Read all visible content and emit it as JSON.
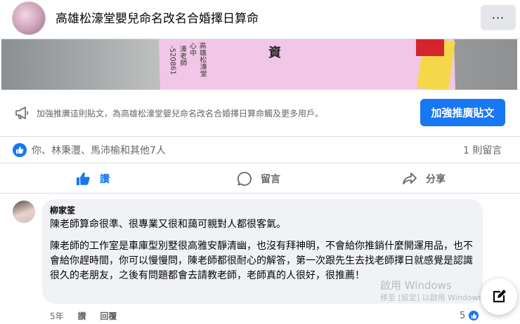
{
  "header": {
    "page_title": "高雄松濠堂嬰兒命名改名合婚擇日算命",
    "more_label": "···"
  },
  "photo": {
    "big_char": "資",
    "line1": "心中",
    "line2": "高雄松濠堂",
    "line3": "濠老師",
    "line4": "-520861"
  },
  "boost": {
    "text": "加強推廣這則貼文，為高雄松濠堂嬰兒命名改名合婚擇日算命觸及更多用戶。",
    "button_label": "加強推廣貼文"
  },
  "reactions": {
    "names": "你、林秉灃、馬沛榆和其他7人",
    "comment_count": "1 則留言"
  },
  "actions": {
    "like": "讚",
    "comment": "留言",
    "share": "分享"
  },
  "comment": {
    "author": "柳家筌",
    "p1": "陳老師算命很準、很專業又很和藹可親對人都很客氣。",
    "p2": "陳老師的工作室是車庫型別墅很高雅安靜清幽，也沒有拜神明，不會給你推銷什麼開運用品，也不會給你趕時間，你可以慢慢問，陳老師都很耐心的解答，第一次跟先生去找老師擇日就感覺是認識很久的老朋友，之後有問題都會去請教老師，老師真的人很好，很推薦！",
    "time": "5年",
    "like_label": "讚",
    "reply_label": "回覆",
    "like_count": "5"
  },
  "watermark": {
    "line1": "啟用 Windows",
    "line2": "移至 [設定] 以啟用 Windows"
  },
  "colors": {
    "accent": "#1877f2",
    "muted": "#65676b",
    "bubble": "#f0f2f5"
  }
}
